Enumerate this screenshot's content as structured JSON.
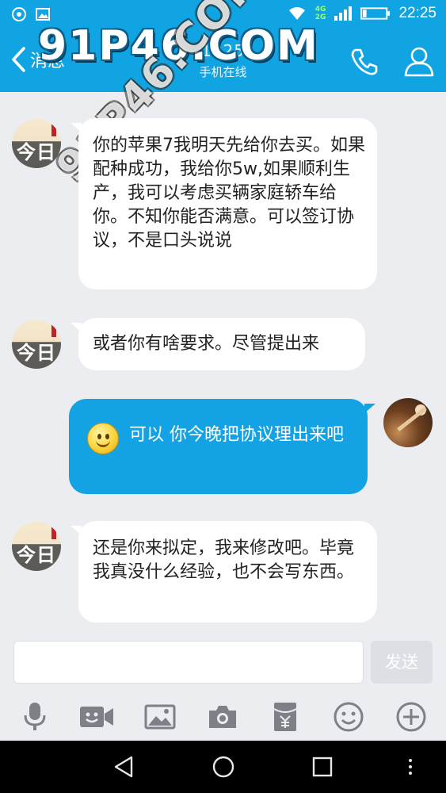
{
  "status_bar": {
    "net_top": "4G",
    "net_bottom": "2G",
    "time": "22:25"
  },
  "header": {
    "back_label": "消息",
    "contact_name": "1025",
    "contact_status": "手机在线"
  },
  "watermark": {
    "text": "91P46.COM"
  },
  "messages": [
    {
      "side": "in",
      "text": "你的苹果7我明天先给你去买。如果配种成功，我给你5w,如果顺利生产，我可以考虑买辆家庭轿车给你。不知你能否满意。可以签订协议，不是口头说说"
    },
    {
      "side": "in",
      "text": "或者你有啥要求。尽管提出来"
    },
    {
      "side": "out",
      "text": "可以 你今晚把协议理出来吧"
    },
    {
      "side": "in",
      "text": "还是你来拟定，我来修改吧。毕竟我真没什么经验，也不会写东西。"
    }
  ],
  "avatar_text": "今日",
  "composer": {
    "input_value": "",
    "send_label": "发送"
  },
  "toolbar": {
    "icons": [
      "microphone-icon",
      "video-icon",
      "image-icon",
      "camera-icon",
      "red-packet-icon",
      "emoji-icon",
      "plus-icon"
    ]
  },
  "colors": {
    "brand": "#11a4e2",
    "outgoing_bubble": "#13a3e4",
    "background": "#ebedf0"
  }
}
